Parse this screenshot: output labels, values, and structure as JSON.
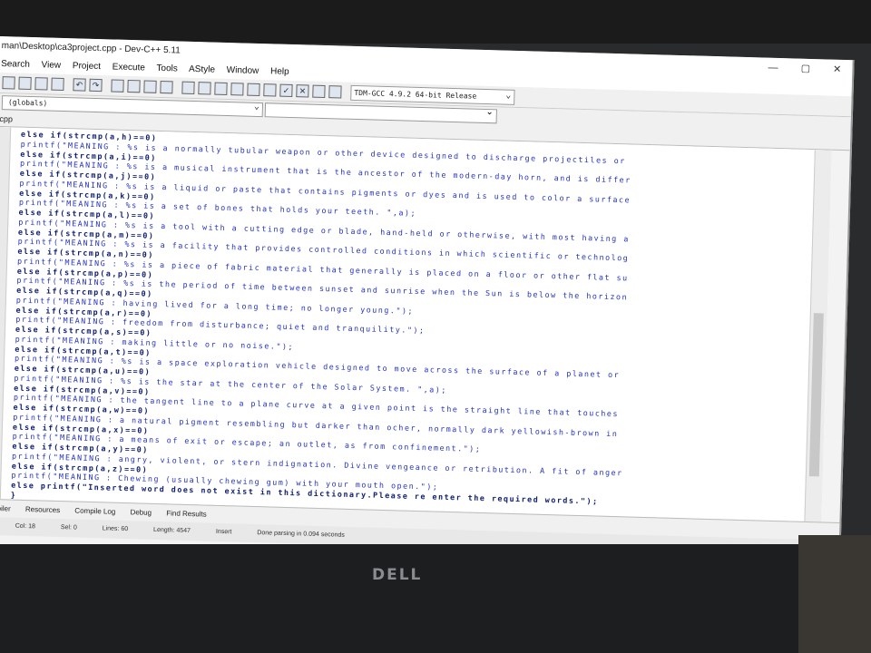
{
  "window": {
    "title": "man\\Desktop\\ca3project.cpp - Dev-C++ 5.11",
    "controls": [
      "—",
      "▢",
      "✕"
    ]
  },
  "menu": [
    "Search",
    "View",
    "Project",
    "Execute",
    "Tools",
    "AStyle",
    "Window",
    "Help"
  ],
  "toolbar": {
    "icons": [
      "undo-icon",
      "redo-icon",
      "compile-icon",
      "run-icon",
      "check-icon",
      "stop-icon",
      "chart-icon"
    ],
    "compiler": "TDM-GCC 4.9.2 64-bit Release"
  },
  "scope_select": "(globals)",
  "tab_label": "cpp",
  "code_lines": [
    "else if(strcmp(a,h)==0)",
    "printf(\"MEANING : %s is a normally tubular weapon or other device designed to discharge projectiles or",
    "else if(strcmp(a,i)==0)",
    "printf(\"MEANING : %s is a musical instrument that is the ancestor of the modern-day horn, and is differ",
    "else if(strcmp(a,j)==0)",
    "printf(\"MEANING : %s is a liquid or paste that contains pigments or dyes and is used to color a surface",
    "else if(strcmp(a,k)==0)",
    "printf(\"MEANING : %s is a set of bones that holds your teeth. \",a);",
    "else if(strcmp(a,l)==0)",
    "printf(\"MEANING : %s is a tool with a cutting edge or blade, hand-held or otherwise, with most having a",
    "else if(strcmp(a,m)==0)",
    "printf(\"MEANING : %s is a facility that provides controlled conditions in which scientific or technolog",
    "else if(strcmp(a,n)==0)",
    "printf(\"MEANING : %s is a piece of fabric material that generally is placed on a floor or other flat su",
    "else if(strcmp(a,p)==0)",
    "printf(\"MEANING : %s is the period of time between sunset and sunrise when the Sun is below the horizon",
    "else if(strcmp(a,q)==0)",
    "printf(\"MEANING : having lived for a long time; no longer young.\");",
    "else if(strcmp(a,r)==0)",
    "printf(\"MEANING : freedom from disturbance; quiet and tranquility.\");",
    "else if(strcmp(a,s)==0)",
    "printf(\"MEANING : making little or no noise.\");",
    "else if(strcmp(a,t)==0)",
    "printf(\"MEANING : %s is a space exploration vehicle designed to move across the surface of a planet or",
    "else if(strcmp(a,u)==0)",
    "printf(\"MEANING : %s is the star at the center of the Solar System. \",a);",
    "else if(strcmp(a,v)==0)",
    "printf(\"MEANING : the tangent line to a plane curve at a given point is the straight line that touches",
    "else if(strcmp(a,w)==0)",
    "printf(\"MEANING : a natural pigment resembling but darker than ocher, normally dark yellowish-brown in",
    "else if(strcmp(a,x)==0)",
    "printf(\"MEANING : a means of exit or escape; an outlet, as from confinement.\");",
    "else if(strcmp(a,y)==0)",
    "printf(\"MEANING : angry, violent, or stern indignation. Divine vengeance or retribution. A fit of anger",
    "else if(strcmp(a,z)==0)",
    "printf(\"MEANING : Chewing (usually chewing gum) with your mouth open.\");",
    "else printf(\"Inserted word does not exist in this dictionary.Please re enter the required words.\");",
    "}"
  ],
  "bottom_tabs": [
    "ompiler",
    "Resources",
    "Compile Log",
    "Debug",
    "Find Results"
  ],
  "status": {
    "row": "1",
    "col": "Col: 18",
    "sel": "Sel: 0",
    "lines": "Lines: 60",
    "length": "Length: 4547",
    "mode": "Insert",
    "message": "Done parsing in 0.094 seconds"
  },
  "monitor_logo": "DELL"
}
